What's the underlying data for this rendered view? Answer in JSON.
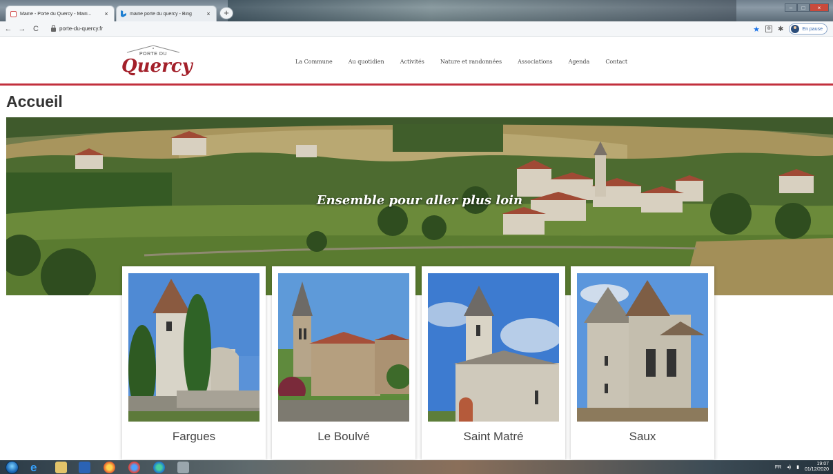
{
  "browser": {
    "tabs": [
      {
        "title": "Mairie - Porte du Quercy - Mairi...",
        "active": true
      },
      {
        "title": "mairie porte du quercy - Bing",
        "active": false
      }
    ],
    "new_tab_symbol": "+",
    "url": "porte-du-quercy.fr",
    "pause_label": "En pause"
  },
  "site": {
    "logo_top": "PORTE DU",
    "logo_main": "Quercy",
    "menu": [
      "La Commune",
      "Au quotidien",
      "Activités",
      "Nature et randonnées",
      "Associations",
      "Agenda",
      "Contact"
    ],
    "page_title": "Accueil",
    "tagline": "Ensemble pour aller plus loin",
    "villages": [
      "Fargues",
      "Le Boulvé",
      "Saint Matré",
      "Saux"
    ]
  },
  "taskbar": {
    "lang": "FR",
    "time": "19:07",
    "date": "01/12/2020"
  },
  "colors": {
    "brand_red": "#c2303d",
    "logo_red": "#a3202a"
  }
}
